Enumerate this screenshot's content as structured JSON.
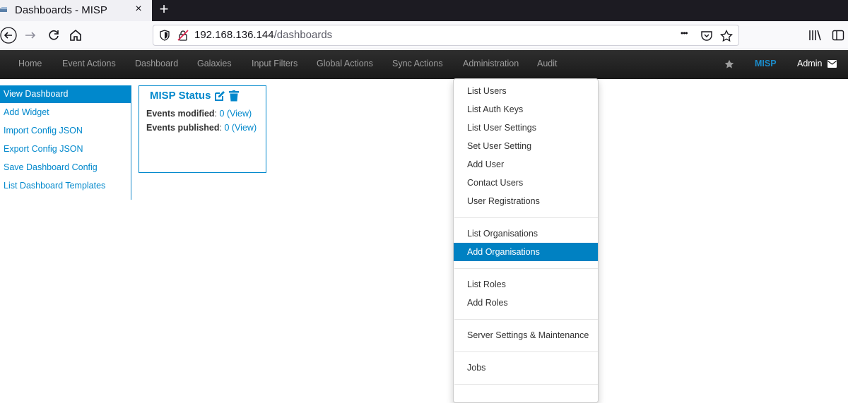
{
  "browser": {
    "tab_title": "Dashboards - MISP",
    "close_glyph": "×",
    "new_tab_glyph": "+",
    "url_host": "192.168.136.144",
    "url_path": "/dashboards",
    "url_more_glyph": "•••",
    "icons": [
      "back-icon",
      "forward-icon",
      "reload-icon",
      "home-icon",
      "shield-icon",
      "insecure-lock-icon",
      "page-actions-icon",
      "pocket-icon",
      "bookmark-star-icon",
      "library-icon",
      "sidebar-icon"
    ]
  },
  "navbar": {
    "items": [
      "Home",
      "Event Actions",
      "Dashboard",
      "Galaxies",
      "Input Filters",
      "Global Actions",
      "Sync Actions",
      "Administration",
      "Audit"
    ],
    "brand": "MISP",
    "user": "Admin",
    "accent_color": "#1b8ccb"
  },
  "sidemenu": {
    "items": [
      "View Dashboard",
      "Add Widget",
      "Import Config JSON",
      "Export Config JSON",
      "Save Dashboard Config",
      "List Dashboard Templates"
    ],
    "active_index": 0
  },
  "widget": {
    "title": "MISP Status",
    "rows": [
      {
        "label": "Events modified",
        "value": "0",
        "link": "View"
      },
      {
        "label": "Events published",
        "value": "0",
        "link": "View"
      }
    ]
  },
  "dropdown": {
    "groups": [
      [
        "List Users",
        "List Auth Keys",
        "List User Settings",
        "Set User Setting",
        "Add User",
        "Contact Users",
        "User Registrations"
      ],
      [
        "List Organisations",
        "Add Organisations"
      ],
      [
        "List Roles",
        "Add Roles"
      ],
      [
        "Server Settings & Maintenance"
      ],
      [
        "Jobs"
      ]
    ],
    "active_item": "Add Organisations",
    "active_color": "#0081c2"
  }
}
